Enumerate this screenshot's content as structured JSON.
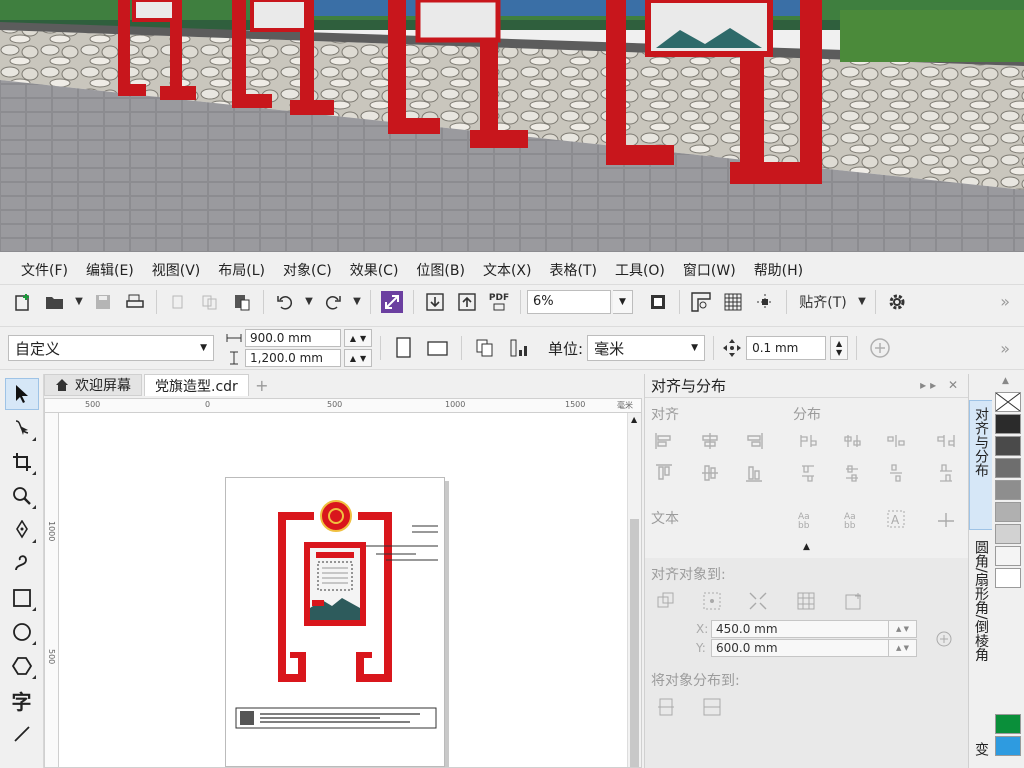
{
  "menu": [
    {
      "label": "文件(F)"
    },
    {
      "label": "编辑(E)"
    },
    {
      "label": "视图(V)"
    },
    {
      "label": "布局(L)"
    },
    {
      "label": "对象(C)"
    },
    {
      "label": "效果(C)"
    },
    {
      "label": "位图(B)"
    },
    {
      "label": "文本(X)"
    },
    {
      "label": "表格(T)"
    },
    {
      "label": "工具(O)"
    },
    {
      "label": "窗口(W)"
    },
    {
      "label": "帮助(H)"
    }
  ],
  "toolbar": {
    "zoom": "6%",
    "pdf_label": "PDF",
    "snap_label": "贴齐(T)",
    "more": "»"
  },
  "property_bar": {
    "page_preset": "自定义",
    "width": "900.0 mm",
    "height": "1,200.0 mm",
    "unit_label": "单位:",
    "unit_value": "毫米",
    "nudge": "0.1 mm"
  },
  "tabs": [
    {
      "label": "欢迎屏幕"
    },
    {
      "label": "党旗造型.cdr"
    }
  ],
  "ruler": {
    "unit": "毫米",
    "h_labels": [
      "500",
      "500",
      "0",
      "500",
      "1000",
      "1500"
    ],
    "v_labels": [
      "1000",
      "500"
    ]
  },
  "docker": {
    "title": "对齐与分布",
    "sec_align": "对齐",
    "sec_distribute": "分布",
    "sec_text": "文本",
    "sec_align_to": "对齐对象到:",
    "x_value": "450.0 mm",
    "y_value": "600.0 mm",
    "x_label": "X:",
    "y_label": "Y:",
    "sec_distribute_to": "将对象分布到:"
  },
  "side_tabs": {
    "align": "对齐与分布",
    "fillet": "圆角/扇形角/倒棱角",
    "trans": "变"
  },
  "palette": [
    "#2b2b2b",
    "#4a4a4a",
    "#6e6e6e",
    "#8e8e8e",
    "#b0b0b0",
    "#d2d2d2",
    "#f4f4f4",
    "#ffffff",
    "#0a8f3a",
    "#2e9be0"
  ],
  "colors": {
    "accent": "#9ec3e6",
    "brand_red": "#d9161c"
  }
}
